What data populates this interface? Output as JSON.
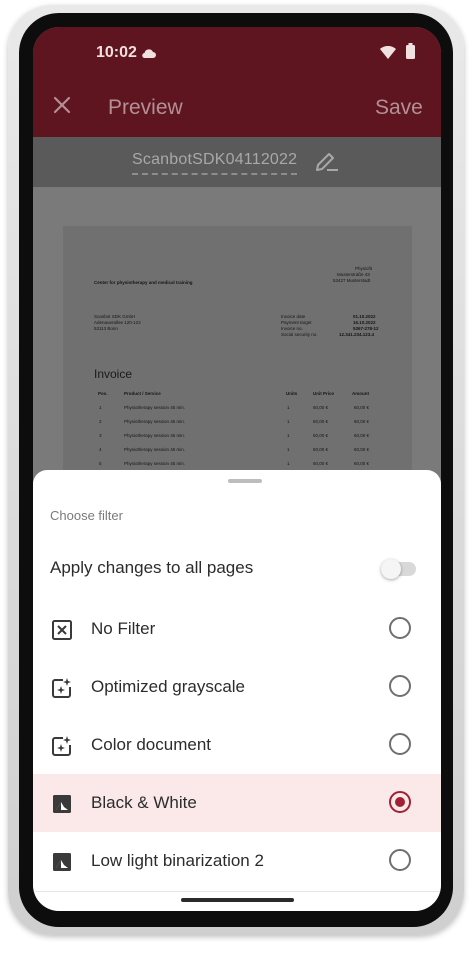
{
  "status": {
    "time": "10:02"
  },
  "appbar": {
    "title": "Preview",
    "save_label": "Save"
  },
  "document": {
    "filename": "ScanbotSDK04112022",
    "company_block": [
      "Physiofit",
      "Musterstraße 43",
      "53427 Musterstadt"
    ],
    "center_name": "Center for physiotherapy and medical training",
    "recipient": [
      "Scanbot SDK GmbH",
      "Adenauerallee 120-122",
      "53113 Bonn"
    ],
    "meta_labels": [
      "Invoice date",
      "Payment target",
      "Invoice no.",
      "Social security no."
    ],
    "meta_values": [
      "01.10.2022",
      "16.10.2022",
      "5367-278-12",
      "12.341.234.123.4"
    ],
    "heading": "Invoice",
    "table_headers": [
      "Pos.",
      "Product / Service",
      "Units",
      "Unit Price",
      "Amount"
    ],
    "table_rows": [
      [
        "1",
        "Physiotherapy session 45 min.",
        "1",
        "60,00 €",
        "60,00 €"
      ],
      [
        "2",
        "Physiotherapy session 45 min.",
        "1",
        "60,00 €",
        "60,00 €"
      ],
      [
        "3",
        "Physiotherapy session 45 min.",
        "1",
        "60,00 €",
        "60,00 €"
      ],
      [
        "4",
        "Physiotherapy session 45 min.",
        "1",
        "60,00 €",
        "60,00 €"
      ],
      [
        "5",
        "Physiotherapy session 45 min.",
        "1",
        "60,00 €",
        "60,00 €"
      ]
    ]
  },
  "sheet": {
    "title": "Choose filter",
    "apply_all_label": "Apply changes to all pages",
    "apply_all_enabled": false,
    "filters": [
      {
        "label": "No Filter",
        "icon": "no-filter-icon",
        "selected": false
      },
      {
        "label": "Optimized grayscale",
        "icon": "sparkle-image-icon",
        "selected": false
      },
      {
        "label": "Color document",
        "icon": "sparkle-image-icon",
        "selected": false
      },
      {
        "label": "Black & White",
        "icon": "contrast-image-icon",
        "selected": true
      },
      {
        "label": "Low light binarization 2",
        "icon": "contrast-image-icon",
        "selected": false
      }
    ]
  },
  "colors": {
    "appbar": "#5f1520",
    "accent": "#9e2236",
    "selected_row": "#fbe9e9"
  }
}
